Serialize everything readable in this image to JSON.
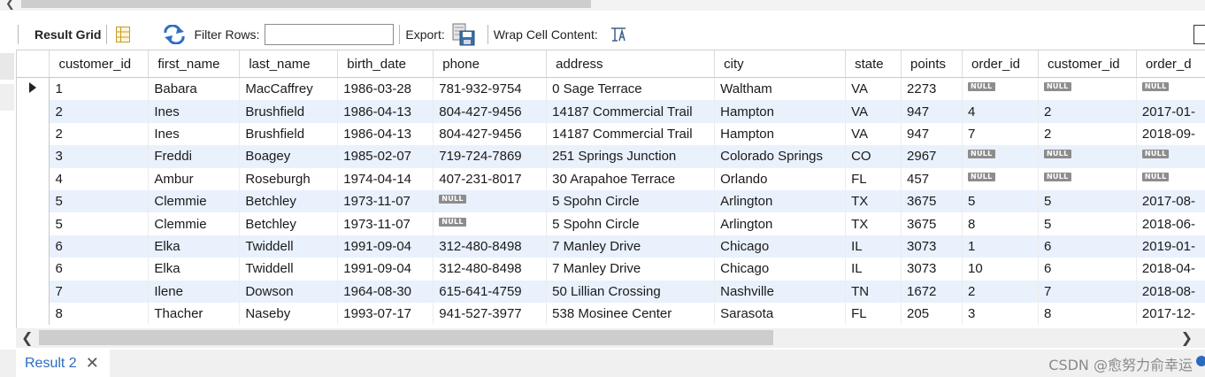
{
  "toolbar": {
    "result_grid_label": "Result Grid",
    "filter_rows_label": "Filter Rows:",
    "filter_value": "",
    "export_label": "Export:",
    "wrap_label": "Wrap Cell Content:"
  },
  "grid": {
    "columns": [
      "customer_id",
      "first_name",
      "last_name",
      "birth_date",
      "phone",
      "address",
      "city",
      "state",
      "points",
      "order_id",
      "customer_id",
      "order_d"
    ],
    "null_text": "NULL",
    "rows": [
      [
        "1",
        "Babara",
        "MacCaffrey",
        "1986-03-28",
        "781-932-9754",
        "0 Sage Terrace",
        "Waltham",
        "VA",
        "2273",
        null,
        null,
        null
      ],
      [
        "2",
        "Ines",
        "Brushfield",
        "1986-04-13",
        "804-427-9456",
        "14187 Commercial Trail",
        "Hampton",
        "VA",
        "947",
        "4",
        "2",
        "2017-01-"
      ],
      [
        "2",
        "Ines",
        "Brushfield",
        "1986-04-13",
        "804-427-9456",
        "14187 Commercial Trail",
        "Hampton",
        "VA",
        "947",
        "7",
        "2",
        "2018-09-"
      ],
      [
        "3",
        "Freddi",
        "Boagey",
        "1985-02-07",
        "719-724-7869",
        "251 Springs Junction",
        "Colorado Springs",
        "CO",
        "2967",
        null,
        null,
        null
      ],
      [
        "4",
        "Ambur",
        "Roseburgh",
        "1974-04-14",
        "407-231-8017",
        "30 Arapahoe Terrace",
        "Orlando",
        "FL",
        "457",
        null,
        null,
        null
      ],
      [
        "5",
        "Clemmie",
        "Betchley",
        "1973-11-07",
        null,
        "5 Spohn Circle",
        "Arlington",
        "TX",
        "3675",
        "5",
        "5",
        "2017-08-"
      ],
      [
        "5",
        "Clemmie",
        "Betchley",
        "1973-11-07",
        null,
        "5 Spohn Circle",
        "Arlington",
        "TX",
        "3675",
        "8",
        "5",
        "2018-06-"
      ],
      [
        "6",
        "Elka",
        "Twiddell",
        "1991-09-04",
        "312-480-8498",
        "7 Manley Drive",
        "Chicago",
        "IL",
        "3073",
        "1",
        "6",
        "2019-01-"
      ],
      [
        "6",
        "Elka",
        "Twiddell",
        "1991-09-04",
        "312-480-8498",
        "7 Manley Drive",
        "Chicago",
        "IL",
        "3073",
        "10",
        "6",
        "2018-04-"
      ],
      [
        "7",
        "Ilene",
        "Dowson",
        "1964-08-30",
        "615-641-4759",
        "50 Lillian Crossing",
        "Nashville",
        "TN",
        "1672",
        "2",
        "7",
        "2018-08-"
      ],
      [
        "8",
        "Thacher",
        "Naseby",
        "1993-07-17",
        "941-527-3977",
        "538 Mosinee Center",
        "Sarasota",
        "FL",
        "205",
        "3",
        "8",
        "2017-12-"
      ]
    ]
  },
  "tabs": [
    {
      "label": "Result 2"
    }
  ],
  "watermark": "CSDN @愈努力俞幸运",
  "icons": {
    "grid": "result-grid-icon",
    "refresh": "refresh-icon",
    "export": "export-icon",
    "wrap": "wrap-cell-icon",
    "close": "close-icon"
  },
  "colors": {
    "row_alt": "#e9f1fc",
    "null_badge": "#8d8d8d",
    "tab_text": "#2a6bc0"
  }
}
